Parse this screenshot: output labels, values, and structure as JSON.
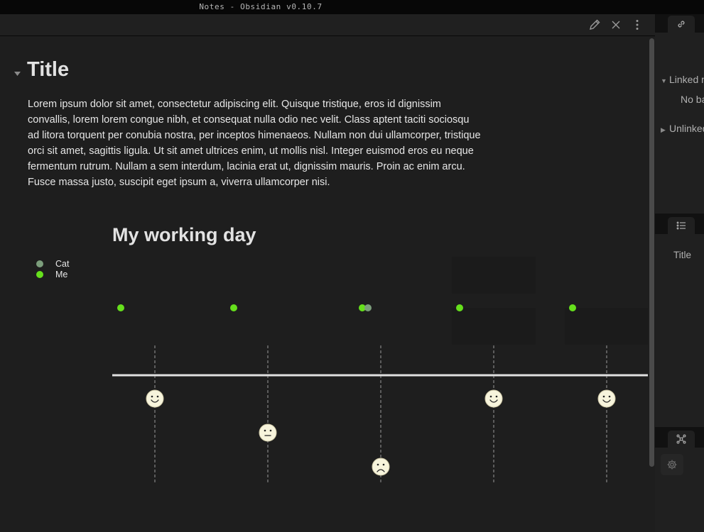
{
  "window": {
    "title": "Notes - Obsidian v0.10.7"
  },
  "document": {
    "title": "Title",
    "paragraph": "Lorem ipsum dolor sit amet, consectetur adipiscing elit. Quisque tristique, eros id dignissim convallis, lorem lorem congue nibh, et consequat nulla odio nec velit. Class aptent taciti sociosqu ad litora torquent per conubia nostra, per inceptos himenaeos. Nullam non dui ullamcorper, tristique orci sit amet, sagittis ligula. Ut sit amet ultrices enim, ut mollis nisl. Integer euismod eros eu neque fermentum rutrum. Nullam a sem interdum, lacinia erat ut, dignissim mauris. Proin ac enim arcu. Fusce massa justo, suscipit eget ipsum a, viverra ullamcorper nisi."
  },
  "header_icons": [
    "pencil-icon",
    "close-icon",
    "more-vertical-icon"
  ],
  "timeline": {
    "title": "My working day",
    "legend": [
      {
        "name": "Cat",
        "color": "#7c9e7c"
      },
      {
        "name": "Me",
        "color": "#66e01c"
      }
    ],
    "items": [
      {
        "mood": "happy"
      },
      {
        "mood": "neutral"
      },
      {
        "mood": "sad",
        "cat": true
      },
      {
        "mood": "happy"
      },
      {
        "mood": "happy"
      }
    ]
  },
  "right_panel": {
    "linked_label": "Linked mentions",
    "no_backlinks": "No backlinks found.",
    "unlinked_label": "Unlinked mentions",
    "outline_item": "Title"
  },
  "colors": {
    "background": "#1e1e1e",
    "me_dot": "#66e01c",
    "cat_dot": "#7c9e7c",
    "face_fill": "#f7f4dc"
  }
}
